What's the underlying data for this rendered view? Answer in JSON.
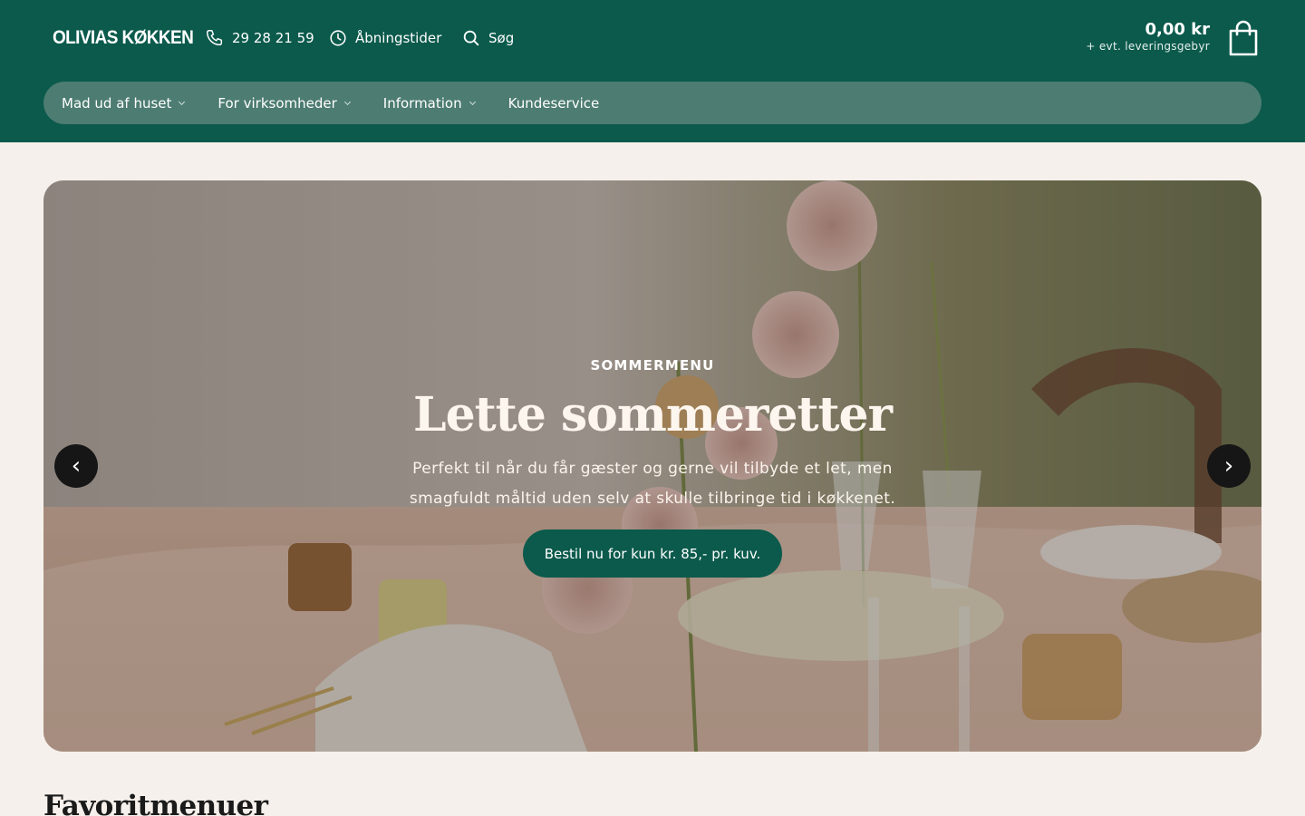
{
  "brand": {
    "logo": "OLIVIAS KØKKEN",
    "primary_color": "#0b5a4c",
    "nav_bg": "#4d7c72",
    "page_bg": "#f5f0eb"
  },
  "topbar": {
    "phone": {
      "icon": "phone-icon",
      "label": "29 28 21 59"
    },
    "hours": {
      "icon": "clock-icon",
      "label": "Åbningstider"
    },
    "search": {
      "icon": "search-icon",
      "label": "Søg"
    }
  },
  "cart": {
    "icon": "shopping-bag-icon",
    "total": "0,00 kr",
    "note": "+ evt. leveringsgebyr"
  },
  "nav": {
    "items": [
      {
        "label": "Mad ud af huset",
        "has_dropdown": true
      },
      {
        "label": "For virksomheder",
        "has_dropdown": true
      },
      {
        "label": "Information",
        "has_dropdown": true
      },
      {
        "label": "Kundeservice",
        "has_dropdown": false
      }
    ]
  },
  "hero": {
    "eyebrow": "SOMMERMENU",
    "title": "Lette sommeretter",
    "description": "Perfekt til når du får gæster og gerne vil tilbyde et let, men smagfuldt måltid uden selv at skulle tilbringe tid i køkkenet.",
    "cta": "Bestil nu for kun kr. 85,- pr. kuv.",
    "prev_label": "‹",
    "next_label": "›"
  },
  "sections": {
    "favorites_title": "Favoritmenuer"
  }
}
